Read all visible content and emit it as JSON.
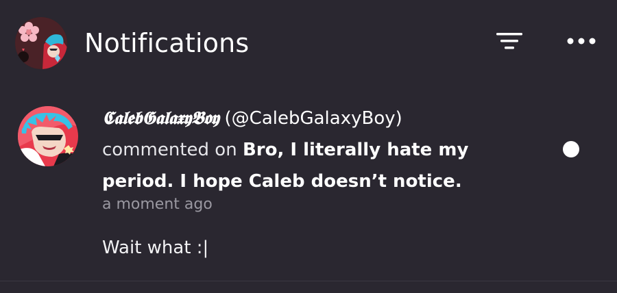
{
  "header": {
    "title": "Notifications",
    "avatar_icon": "profile-avatar-icon",
    "filter_icon": "filter-icon",
    "more_icon": "more-options-icon"
  },
  "notifications": [
    {
      "display_name": "𝕮𝖆𝖑𝖊𝖇𝕲𝖆𝖑𝖆𝖝𝖞𝕭𝖔𝖞",
      "handle": "(@CalebGalaxyBoy)",
      "verb": "commented on",
      "post_title_line1": "Bro, I literally hate my",
      "post_title_line2": "period. I hope Caleb doesn’t notice.",
      "timestamp": "a moment ago",
      "comment": "Wait what :|",
      "unread": true
    }
  ],
  "colors": {
    "background": "#2a2730",
    "text": "#ffffff",
    "muted": "#9a98a1",
    "divider": "#3b3842"
  }
}
